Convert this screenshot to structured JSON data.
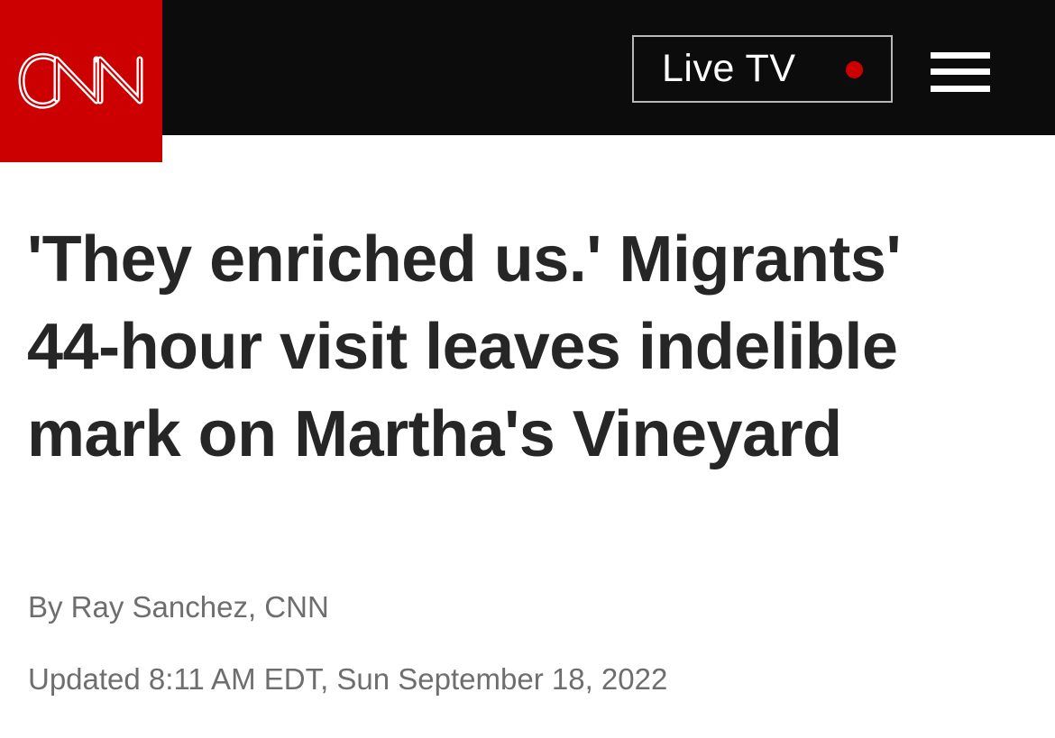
{
  "header": {
    "logo_text": "CNN",
    "live_tv_label": "Live TV",
    "live_indicator_color": "#cc0000",
    "brand_color": "#cc0000",
    "bar_color": "#0c0c0c",
    "menu_icon": "hamburger-menu-icon"
  },
  "article": {
    "headline": "'They enriched us.' Migrants' 44-hour visit leaves indelible mark on Martha's Vineyard",
    "byline": "By Ray Sanchez, CNN",
    "updated": "Updated 8:11 AM EDT, Sun September 18, 2022"
  }
}
